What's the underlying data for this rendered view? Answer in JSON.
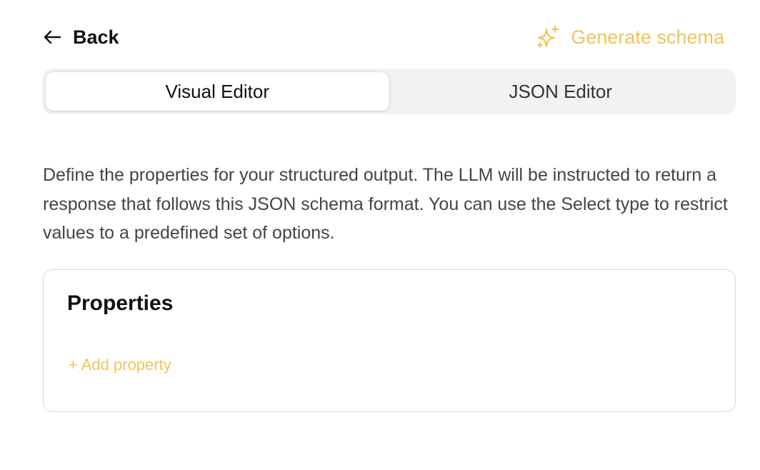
{
  "header": {
    "back_label": "Back",
    "generate_label": "Generate schema"
  },
  "icons": {
    "back": "arrow-left-icon",
    "generate": "sparkles-icon"
  },
  "tabs": [
    {
      "label": "Visual Editor",
      "active": true
    },
    {
      "label": "JSON Editor",
      "active": false
    }
  ],
  "description": "Define the properties for your structured output. The LLM will be instructed to return a response that follows this JSON schema format. You can use the Select type to restrict values to a predefined set of options.",
  "properties": {
    "title": "Properties",
    "add_label": "+ Add property"
  },
  "colors": {
    "accent": "#f2c35a",
    "text": "#111111",
    "muted_text": "#444444",
    "tab_track": "#f2f2f2",
    "card_border": "#d6d6d6"
  }
}
